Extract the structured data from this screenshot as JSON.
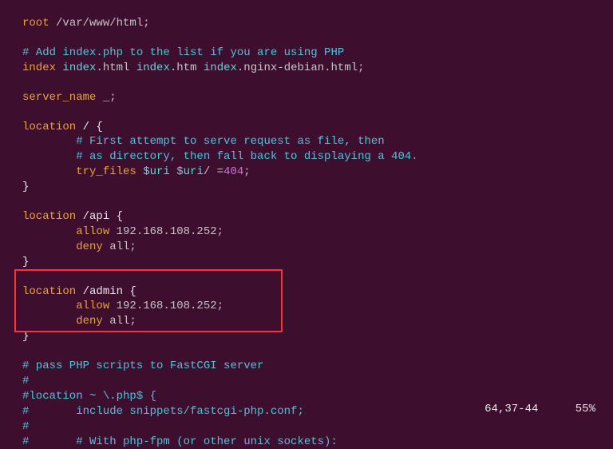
{
  "lines": {
    "l1_kw": "root",
    "l1_path": " /var/www/html;",
    "l3_com": "# Add index.php to the list if you are using PHP",
    "l4_kw1": "index",
    "l4_dir1": " index",
    "l4_s1": ".html",
    "l4_dir2": " index",
    "l4_s2": ".htm",
    "l4_dir3": " index",
    "l4_s3": ".nginx-debian.html;",
    "l6_kw": "server_name",
    "l6_v": " _;",
    "l8_kw": "location",
    "l8_v": " / {",
    "l9": "        # First attempt to serve request as file, then",
    "l10": "        # as directory, then fall back to displaying a 404.",
    "l11_kw": "        try_files",
    "l11_v1": " $uri",
    "l11_v2": " $uri",
    "l11_s": "/ =",
    "l11_n": "404",
    "l11_e": ";",
    "l12": "}",
    "l14_kw": "location",
    "l14_v": " /api {",
    "l15_kw": "        allow",
    "l15_v": " 192.168.108.252;",
    "l16_kw": "        deny",
    "l16_v": " all;",
    "l17": "}",
    "l19_kw": "location",
    "l19_v": " /admin {",
    "l20_kw": "        allow",
    "l20_v": " 192.168.108.252;",
    "l21_kw": "        deny",
    "l21_v": " all;",
    "l22": "}",
    "l24": "# pass PHP scripts to FastCGI server",
    "l25": "#",
    "l26": "#location ~ \\.php$ {",
    "l27": "#       include snippets/fastcgi-php.conf;",
    "l28": "#",
    "l29": "#       # With php-fpm (or other unix sockets):"
  },
  "status": {
    "pos": "64,37-44",
    "pct": "55%"
  }
}
